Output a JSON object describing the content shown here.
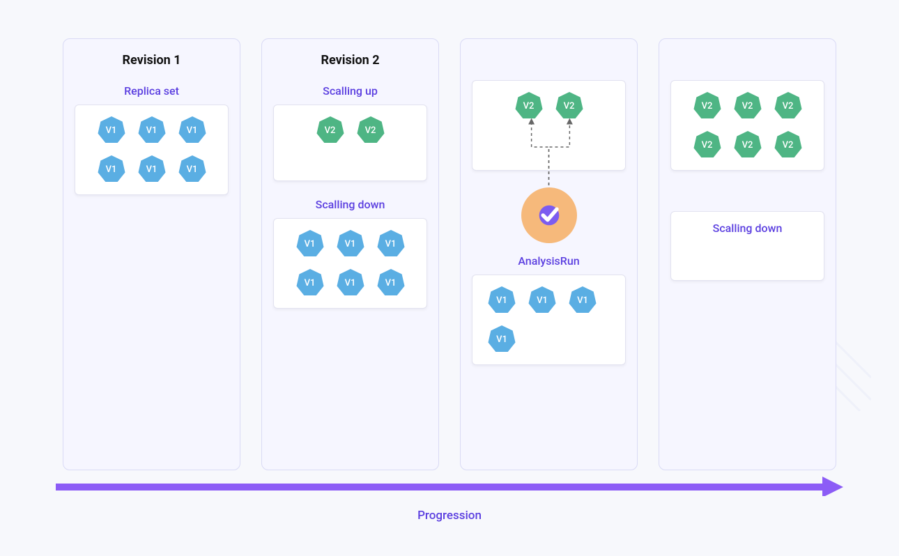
{
  "columns": [
    {
      "title": "Revision 1",
      "sections": [
        {
          "label": "Replica set",
          "pods": [
            "V1",
            "V1",
            "V1",
            "V1",
            "V1",
            "V1"
          ],
          "color": "#5aaee3"
        }
      ]
    },
    {
      "title": "Revision 2",
      "sections": [
        {
          "label": "Scalling up",
          "pods": [
            "V2",
            "V2"
          ],
          "color": "#4eb584"
        },
        {
          "label": "Scalling down",
          "pods": [
            "V1",
            "V1",
            "V1",
            "V1",
            "V1",
            "V1"
          ],
          "color": "#5aaee3"
        }
      ]
    },
    {
      "title": "",
      "sections": [
        {
          "label": "",
          "pods": [
            "V2",
            "V2"
          ],
          "color": "#4eb584"
        },
        {
          "label": "AnalysisRun",
          "pods": [
            "V1",
            "V1",
            "V1",
            "V1"
          ],
          "color": "#5aaee3",
          "analysis": true
        }
      ]
    },
    {
      "title": "",
      "sections": [
        {
          "label": "",
          "pods": [
            "V2",
            "V2",
            "V2",
            "V2",
            "V2",
            "V2"
          ],
          "color": "#4eb584"
        },
        {
          "label": "",
          "scalling_down_text": "Scalling down"
        }
      ]
    }
  ],
  "progression_label": "Progression",
  "colors": {
    "v1": "#5aaee3",
    "v2": "#4eb584",
    "accent": "#5b3fe0",
    "arrow": "#8c5cf6",
    "badge_bg": "#f6b97b",
    "badge_check": "#7c5cf0"
  }
}
